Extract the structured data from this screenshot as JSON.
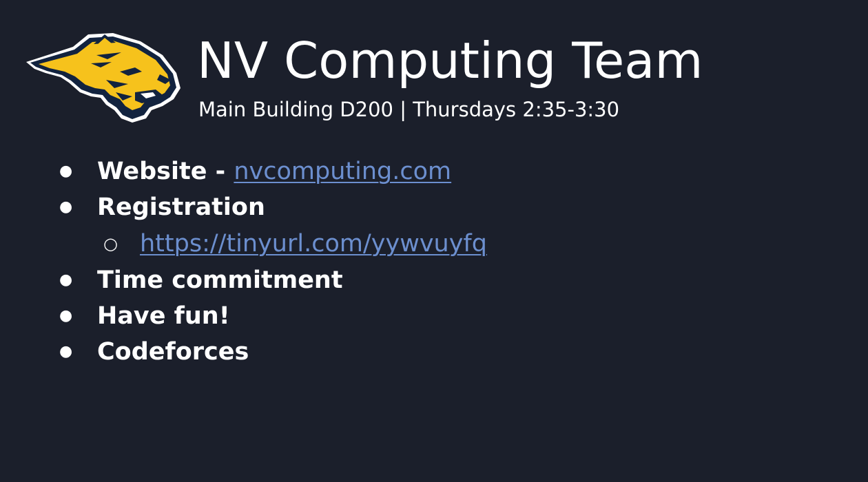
{
  "slide": {
    "title": "NV Computing Team",
    "subtitle": "Main Building D200 | Thursdays 2:35-3:30",
    "logo_icon": "wildcat-mascot-logo",
    "colors": {
      "background": "#1b1f2b",
      "text": "#ffffff",
      "link": "#6c8fcf",
      "logo_gold": "#f6c21c",
      "logo_navy": "#12233f"
    }
  },
  "bullets": [
    {
      "label": "Website - ",
      "link": "nvcomputing.com",
      "bullet_char": "●"
    },
    {
      "label": "Registration",
      "bullet_char": "●"
    },
    {
      "link": "https://tinyurl.com/yywvuyfq",
      "bullet_char": "○"
    },
    {
      "label": "Time commitment",
      "bullet_char": "●"
    },
    {
      "label": "Have fun!",
      "bullet_char": "●"
    },
    {
      "label": "Codeforces",
      "bullet_char": "●"
    }
  ]
}
